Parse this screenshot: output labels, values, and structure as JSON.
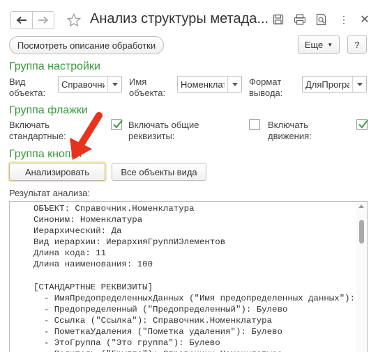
{
  "window": {
    "title": "Анализ структуры метада..."
  },
  "commandbar": {
    "describe_label": "Посмотреть описание обработки",
    "more_label": "Еще",
    "help_label": "?"
  },
  "settings_group": {
    "title": "Группа настройки",
    "object_kind_label": "Вид объекта:",
    "object_kind_value": "Справочник",
    "object_name_label": "Имя объекта:",
    "object_name_value": "Номенклатура",
    "output_format_label": "Формат вывода:",
    "output_format_value": "ДляПрограммиста"
  },
  "flags_group": {
    "title": "Группа флажки",
    "standard_label": "Включать стандартные:",
    "standard_checked": true,
    "common_label": "Включать общие реквизиты:",
    "common_checked": false,
    "movements_label": "Включать движения:",
    "movements_checked": true
  },
  "buttons_group": {
    "title": "Группа кнопки",
    "analyze_label": "Анализировать",
    "all_objects_label": "Все объекты вида"
  },
  "result": {
    "label": "Результат анализа:",
    "lines": [
      "ОБЪЕКТ: Справочник.Номенклатура",
      "Синоним: Номенклатура",
      "Иерархический: Да",
      "Вид иерархии: ИерархияГруппИЭлементов",
      "Длина кода: 11",
      "Длина наименования: 100",
      "",
      "[СТАНДАРТНЫЕ РЕКВИЗИТЫ]",
      "  - ИмяПредопределенныхДанных (\"Имя предопределенных данных\"): Строка",
      "  - Предопределенный (\"Предопределенный\"): Булево",
      "  - Ссылка (\"Ссылка\"): Справочник.Номенклатура",
      "  - ПометкаУдаления (\"Пометка удаления\"): Булево",
      "  - ЭтоГруппа (\"Это группа\"): Булево",
      "  - Родитель (\"Группа\"): Справочник.Номенклатура"
    ]
  },
  "colors": {
    "group_title": "#3a9a3c",
    "check_mark": "#3a9a3c",
    "annotation_arrow": "#e8321e"
  }
}
